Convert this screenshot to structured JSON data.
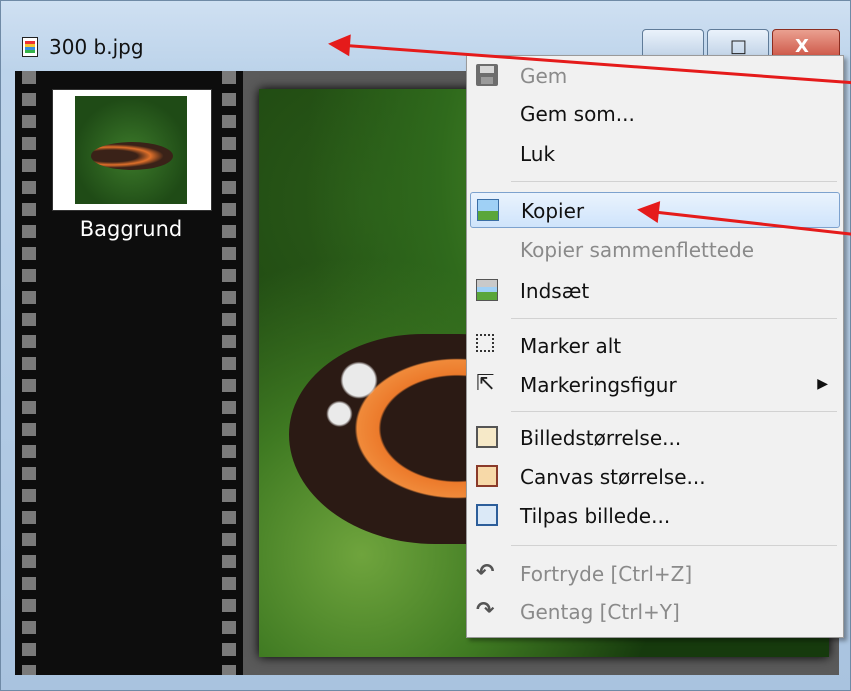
{
  "window": {
    "title": "300 b.jpg",
    "icon": "image-file-icon",
    "controls": {
      "minimize_icon": "minimize-icon",
      "maximize_glyph": "□",
      "close_glyph": "X"
    }
  },
  "filmstrip": {
    "thumbnail_label": "Baggrund"
  },
  "context_menu": {
    "items": [
      {
        "label": "Gem",
        "icon": "save-icon",
        "enabled": false
      },
      {
        "label": "Gem som...",
        "icon": "",
        "enabled": true
      },
      {
        "label": "Luk",
        "icon": "",
        "enabled": true
      },
      {
        "label": "Kopier",
        "icon": "copy-image-icon",
        "enabled": true,
        "highlighted": true
      },
      {
        "label": "Kopier sammenflettede",
        "icon": "",
        "enabled": false
      },
      {
        "label": "Indsæt",
        "icon": "paste-image-icon",
        "enabled": true
      },
      {
        "label": "Marker alt",
        "icon": "select-all-icon",
        "enabled": true
      },
      {
        "label": "Markeringsfigur",
        "icon": "cursor-icon",
        "enabled": true,
        "submenu": true
      },
      {
        "label": "Billedstørrelse...",
        "icon": "image-size-icon",
        "enabled": true
      },
      {
        "label": "Canvas størrelse...",
        "icon": "canvas-size-icon",
        "enabled": true
      },
      {
        "label": "Tilpas billede...",
        "icon": "fit-image-icon",
        "enabled": true
      },
      {
        "label": "Fortryde [Ctrl+Z]",
        "icon": "undo-icon",
        "enabled": false
      },
      {
        "label": "Gentag [Ctrl+Y]",
        "icon": "redo-icon",
        "enabled": false
      }
    ],
    "submenu_glyph": "▶"
  },
  "colors": {
    "annotation_arrow": "#e51b1b",
    "menu_highlight": "#cfe4fb"
  }
}
